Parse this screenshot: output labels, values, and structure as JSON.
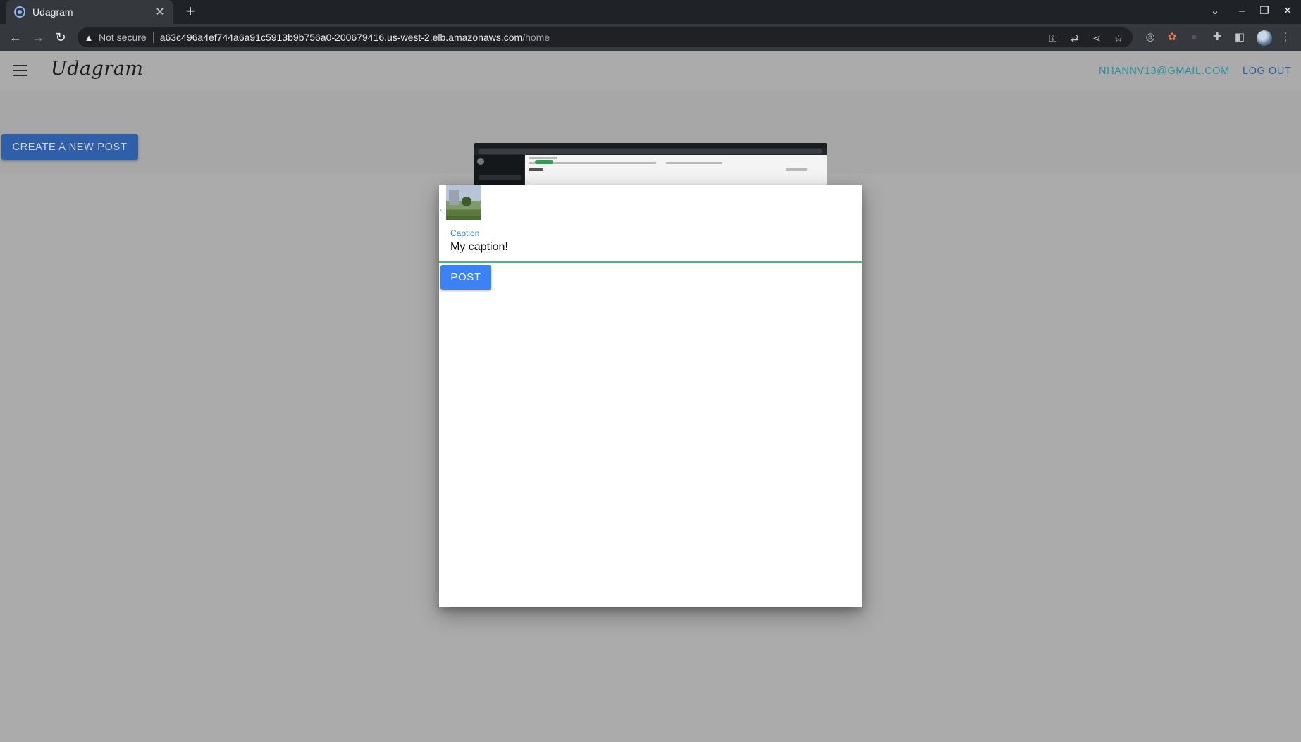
{
  "browser": {
    "tab_title": "Udagram",
    "new_tab": "+",
    "security_label": "Not secure",
    "url_host": "a63c496a4ef744a6a91c5913b9b756a0-200679416.us-west-2.elb.amazonaws.com",
    "url_path": "/home"
  },
  "app": {
    "brand": "Udagram",
    "user_email": "NHANNV13@GMAIL.COM",
    "logout_label": "LOG OUT",
    "create_post_label": "CREATE A NEW POST"
  },
  "modal": {
    "caption_label": "Caption",
    "caption_value": "My caption!",
    "post_label": "POST"
  },
  "colors": {
    "accent_blue": "#3b82f6",
    "input_underline": "#3bbf7a",
    "create_button": "#2f5fa8",
    "email_teal": "#2d8e9e"
  },
  "icons": [
    "tab-favicon-icon",
    "tab-close-icon",
    "new-tab-icon",
    "chevron-down-icon",
    "minimize-icon",
    "restore-icon",
    "close-window-icon",
    "back-icon",
    "forward-icon",
    "reload-icon",
    "warning-icon",
    "key-icon",
    "translate-icon",
    "share-icon",
    "bookmark-star-icon",
    "extension-icon",
    "puzzle-icon",
    "sidebar-icon",
    "profile-avatar",
    "more-menu-icon",
    "hamburger-menu-icon"
  ]
}
